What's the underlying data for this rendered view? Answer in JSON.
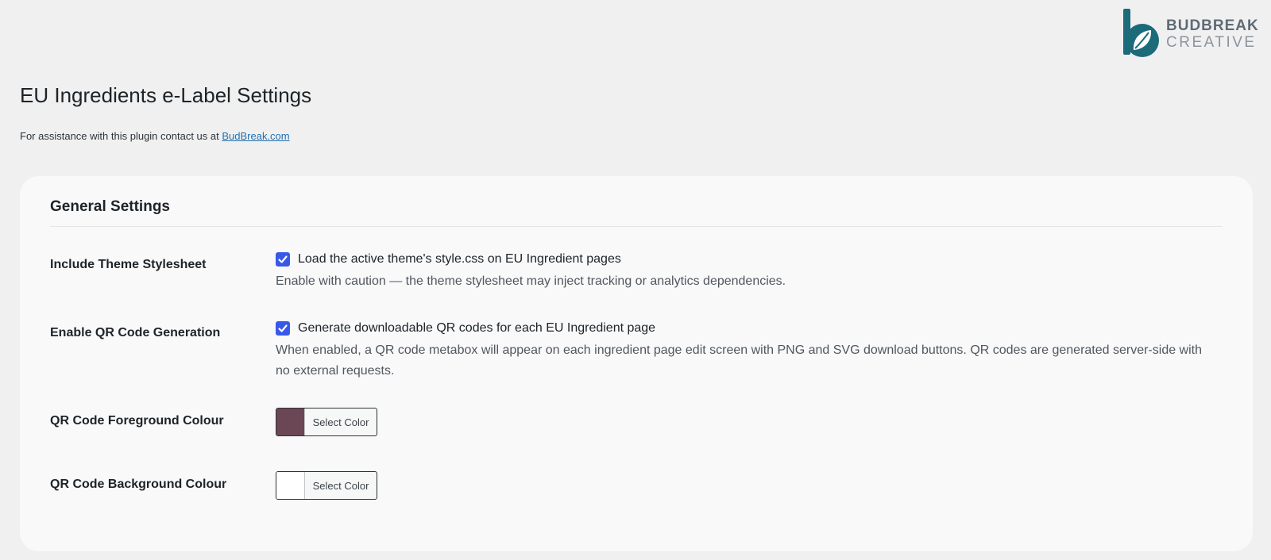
{
  "brand": {
    "line1": "BUDBREAK",
    "line2": "CREATIVE",
    "logo_color": "#1c6b7a"
  },
  "page": {
    "title": "EU Ingredients e-Label Settings",
    "assist_text": "For assistance with this plugin contact us at ",
    "assist_link": "BudBreak.com"
  },
  "general": {
    "title": "General Settings",
    "theme_stylesheet": {
      "label": "Include Theme Stylesheet",
      "checkbox_label": "Load the active theme's style.css on EU Ingredient pages",
      "checked": true,
      "description": "Enable with caution — the theme stylesheet may inject tracking or analytics dependencies."
    },
    "qr_generation": {
      "label": "Enable QR Code Generation",
      "checkbox_label": "Generate downloadable QR codes for each EU Ingredient page",
      "checked": true,
      "description": "When enabled, a QR code metabox will appear on each ingredient page edit screen with PNG and SVG download buttons. QR codes are generated server-side with no external requests."
    },
    "qr_foreground": {
      "label": "QR Code Foreground Colour",
      "button_label": "Select Color",
      "color": "#6b4654"
    },
    "qr_background": {
      "label": "QR Code Background Colour",
      "button_label": "Select Color",
      "color": "#ffffff"
    }
  },
  "colors": {
    "accent": "#3858e9",
    "link": "#2271b1"
  }
}
